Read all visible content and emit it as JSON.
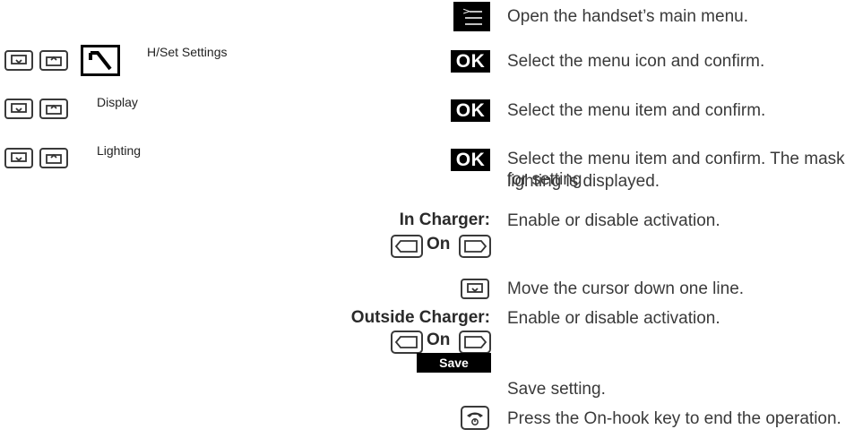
{
  "steps": [
    {
      "description": "Open the handset’s main menu."
    },
    {
      "screen_label": "H/Set Settings",
      "action": "OK",
      "description": "Select the menu icon and confirm."
    },
    {
      "screen_label": "Display",
      "action": "OK",
      "description": "Select the menu item and confirm."
    },
    {
      "screen_label": "Lighting",
      "action": "OK",
      "description_line1": "Select the menu item and confirm. The mask for setting",
      "description_line2": "lighting is displayed."
    },
    {
      "label": "In Charger:",
      "toggle": "On",
      "description": "Enable or disable activation."
    },
    {
      "description": "Move the cursor down one line."
    },
    {
      "label": "Outside Charger:",
      "toggle": "On",
      "description": "Enable or disable activation."
    },
    {
      "button": "Save",
      "description": "Save setting."
    },
    {
      "description": "Press the On-hook key to end the operation."
    }
  ]
}
